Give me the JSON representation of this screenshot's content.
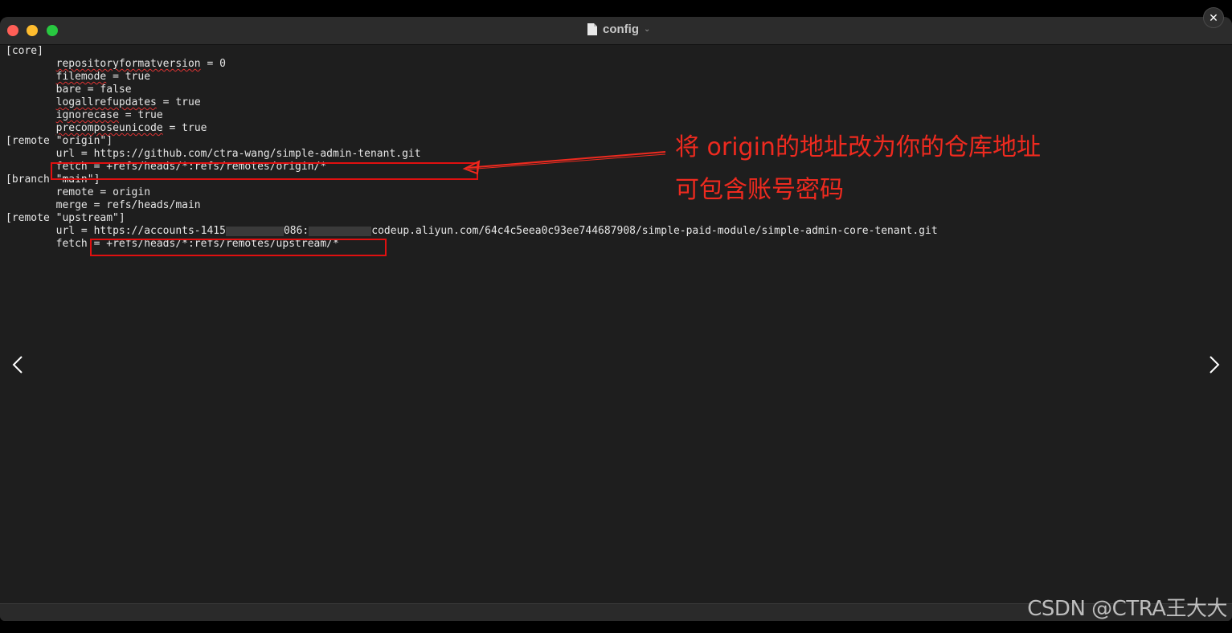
{
  "window": {
    "title": "config",
    "title_chevron": "⌄"
  },
  "editor": {
    "lines": {
      "l1": "[core]",
      "l2_key": "repositoryformatversion",
      "l2_rest": " = 0",
      "l3_key": "filemode",
      "l3_rest": " = true",
      "l4": "bare = false",
      "l5_key": "logallrefupdates",
      "l5_rest": " = true",
      "l6_key": "ignorecase",
      "l6_rest": " = true",
      "l7_key": "precomposeunicode",
      "l7_rest": " = true",
      "l8": "[remote \"origin\"]",
      "l9": "url = https://github.com/ctra-wang/simple-admin-tenant.git",
      "l10": "fetch = +refs/heads/*:refs/remotes/origin/*",
      "l11": "[branch \"main\"]",
      "l12": "remote = origin",
      "l13": "merge = refs/heads/main",
      "l14": "[remote \"upstream\"]",
      "l15_a": "url = https://accounts-1415",
      "l15_b": "086:",
      "l15_c": "codeup.aliyun.com/64c4c5eea0c93ee744687908/simple-paid-module/simple-admin-core-tenant.git",
      "l16": "fetch = +refs/heads/*:refs/remotes/upstream/*"
    }
  },
  "annotation": {
    "line1": "将 origin的地址改为你的仓库地址",
    "line2": "可包含账号密码",
    "color": "#ee2a1f"
  },
  "watermark": "CSDN @CTRA王大大",
  "close_label": "✕"
}
